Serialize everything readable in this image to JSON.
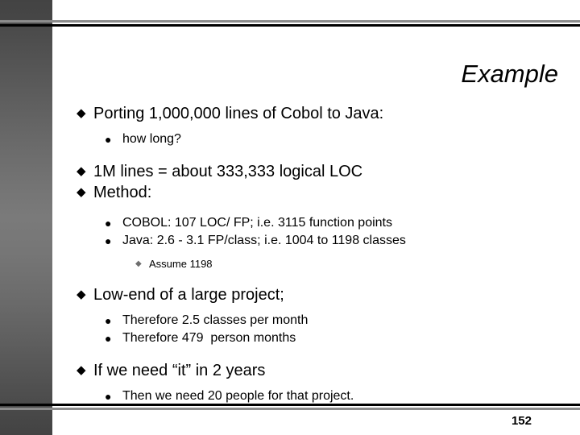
{
  "slide": {
    "title": "Example",
    "page_number": "152",
    "bullet_glyphs": {
      "level1": "◆",
      "level2": "●",
      "level3": "◆"
    },
    "colors": {
      "text": "#000000",
      "rule_black": "#000000",
      "rule_gray": "#8c8c8c",
      "sidebar_dark": "#434343",
      "sidebar_light": "#7a7a7a",
      "level3_bullet": "#6e6e6e"
    },
    "blocks": [
      {
        "level": 1,
        "text": "Porting 1,000,000 lines of Cobol to Java:"
      },
      {
        "level": 2,
        "text": "how long?"
      },
      {
        "level": 1,
        "text": "1M lines = about 333,333 logical LOC"
      },
      {
        "level": 1,
        "text": "Method:"
      },
      {
        "level": 2,
        "text": "COBOL: 107 LOC/ FP; i.e. 3115 function points"
      },
      {
        "level": 2,
        "text": "Java: 2.6 - 3.1 FP/class; i.e. 1004 to 1198 classes"
      },
      {
        "level": 3,
        "text": "Assume 1198"
      },
      {
        "level": 1,
        "text": "Low-end of a large project;"
      },
      {
        "level": 2,
        "text": "Therefore 2.5 classes per month"
      },
      {
        "level": 2,
        "text": "Therefore 479  person months"
      },
      {
        "level": 1,
        "text": "If we need “it” in 2 years"
      },
      {
        "level": 2,
        "text": "Then we need 20 people for that project."
      }
    ]
  }
}
